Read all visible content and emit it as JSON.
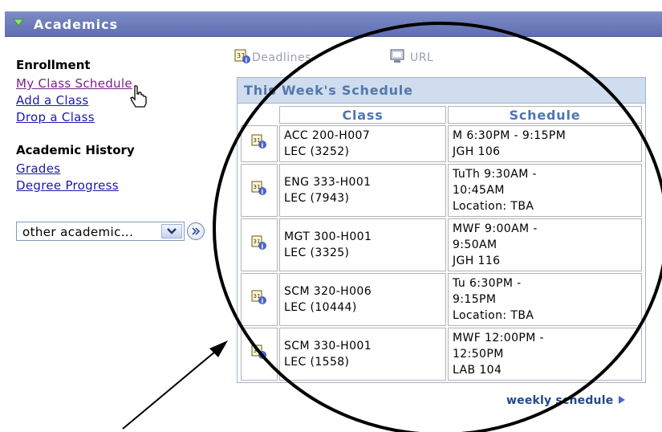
{
  "header": {
    "title": "Academics"
  },
  "left": {
    "enrollment_title": "Enrollment",
    "links": [
      "My Class Schedule",
      "Add a Class",
      "Drop a Class"
    ],
    "history_title": "Academic History",
    "history_links": [
      "Grades",
      "Degree Progress"
    ],
    "select_value": "other academic..."
  },
  "toolbar": {
    "deadlines": "Deadlines",
    "url": "URL"
  },
  "schedule": {
    "title": "This Week's Schedule",
    "col_class": "Class",
    "col_schedule": "Schedule",
    "rows": [
      {
        "class": [
          "ACC 200-H007",
          "LEC (3252)"
        ],
        "schedule": [
          "M 6:30PM - 9:15PM",
          "JGH 106"
        ]
      },
      {
        "class": [
          "ENG 333-H001",
          "LEC (7943)"
        ],
        "schedule": [
          "TuTh 9:30AM -",
          "10:45AM",
          "Location:  TBA"
        ]
      },
      {
        "class": [
          "MGT 300-H001",
          "LEC (3325)"
        ],
        "schedule": [
          "MWF 9:00AM -",
          "9:50AM",
          "JGH 116"
        ]
      },
      {
        "class": [
          "SCM 320-H006",
          "LEC (10444)"
        ],
        "schedule": [
          "Tu 6:30PM -",
          "9:15PM",
          "Location:  TBA"
        ]
      },
      {
        "class": [
          "SCM 330-H001",
          "LEC (1558)"
        ],
        "schedule": [
          "MWF 12:00PM -",
          "12:50PM",
          "LAB 104"
        ]
      }
    ]
  },
  "footer_link": "weekly schedule",
  "colors": {
    "header": "#6b7bbd",
    "link": "#1a1aa6",
    "visited": "#7a1f8a",
    "table_head": "#cfddee"
  },
  "icons": [
    "triangle-down-icon",
    "calendar-info-icon",
    "url-icon",
    "chevron-right-icon",
    "double-arrow-icon",
    "hand-cursor-icon"
  ]
}
